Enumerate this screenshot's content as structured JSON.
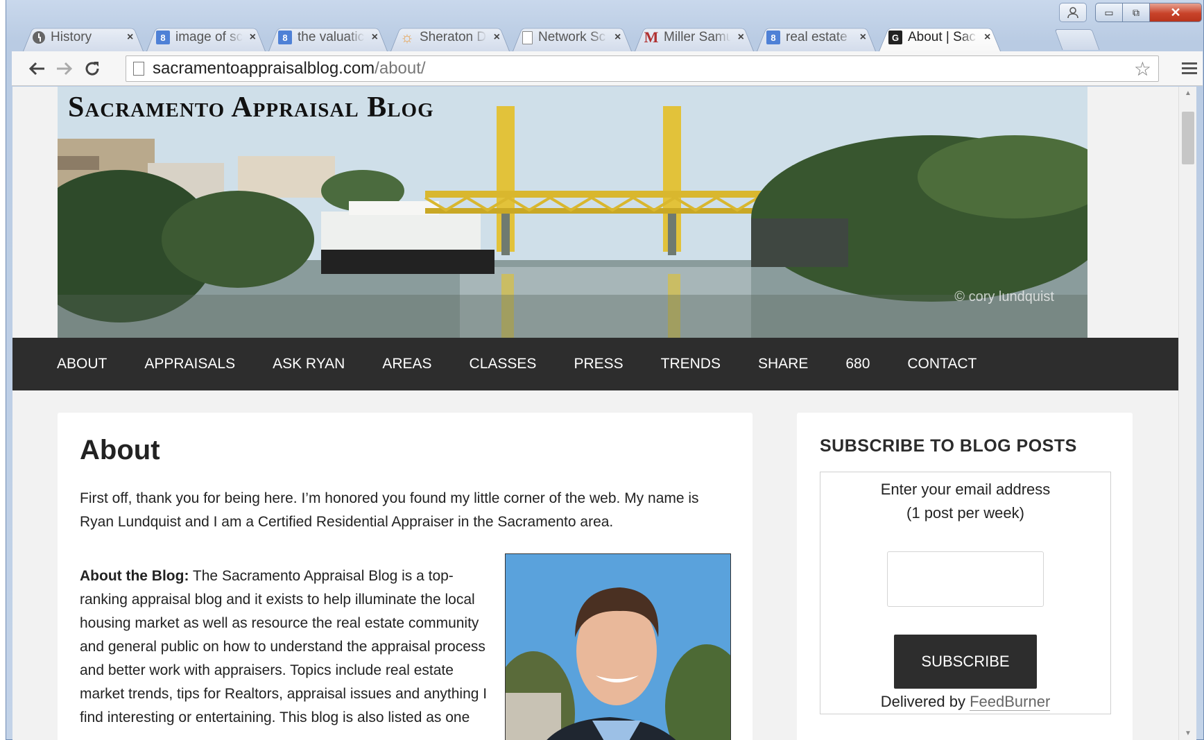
{
  "browser": {
    "tabs": [
      {
        "title": "History",
        "icon": "history-icon"
      },
      {
        "title": "image of sc",
        "icon": "google-icon"
      },
      {
        "title": "the valuatic",
        "icon": "google-icon"
      },
      {
        "title": "Sheraton D",
        "icon": "sheraton-icon"
      },
      {
        "title": "Network Sc",
        "icon": "document-icon"
      },
      {
        "title": "Miller Samu",
        "icon": "gmail-icon"
      },
      {
        "title": "real estate",
        "icon": "google-icon"
      },
      {
        "title": "About | Sac",
        "icon": "site-icon"
      }
    ],
    "favicon_letters": {
      "google": "8",
      "site": "G",
      "gmail": "M",
      "sun": "☼"
    },
    "tab_close": "×",
    "url_domain": "sacramentoappraisalblog.com",
    "url_path": "/about/"
  },
  "site": {
    "title": "Sacramento Appraisal Blog",
    "photo_credit": "© cory lundquist",
    "nav": [
      "ABOUT",
      "APPRAISALS",
      "ASK RYAN",
      "AREAS",
      "CLASSES",
      "PRESS",
      "TRENDS",
      "SHARE",
      "680",
      "CONTACT"
    ]
  },
  "main": {
    "heading": "About",
    "intro": "First off, thank you for being here. I’m honored you found my little corner of the web. My name is Ryan Lundquist and I am a Certified Residential Appraiser in the Sacramento area.",
    "about_label": "About the Blog:",
    "about_text": " The Sacramento Appraisal Blog is a top-ranking appraisal blog and it exists to help illuminate the local housing market as well as resource the real estate community and general public on how to understand the appraisal process and better work with appraisers. Topics include real estate market trends, tips for Realtors, appraisal issues and anything I find interesting or entertaining. This blog is also listed as one"
  },
  "sidebar": {
    "heading": "SUBSCRIBE TO BLOG POSTS",
    "line1": "Enter your email address",
    "line2": "(1 post per week)",
    "email_value": "",
    "button": "SUBSCRIBE",
    "delivered_prefix": "Delivered by ",
    "delivered_link": "FeedBurner"
  }
}
